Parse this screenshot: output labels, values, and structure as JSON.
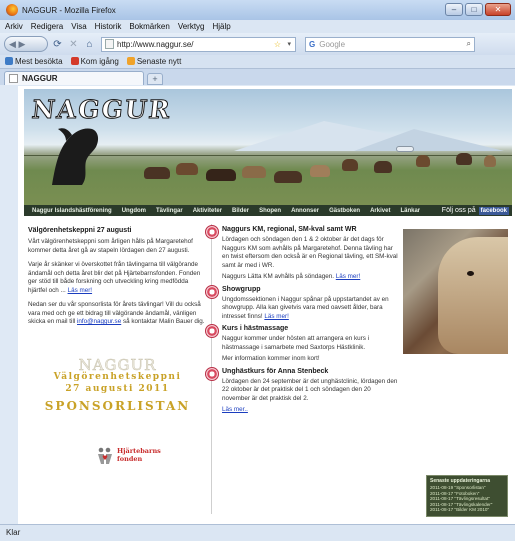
{
  "window": {
    "title": "NAGGUR - Mozilla Firefox"
  },
  "menubar": [
    "Arkiv",
    "Redigera",
    "Visa",
    "Historik",
    "Bokmärken",
    "Verktyg",
    "Hjälp"
  ],
  "navbar": {
    "url": "http://www.naggur.se/",
    "search_placeholder": "Google",
    "search_engine_logo": "G"
  },
  "bookmarks": [
    "Mest besökta",
    "Kom igång",
    "Senaste nytt"
  ],
  "tabs": [
    {
      "label": "NAGGUR"
    }
  ],
  "status": "Klar",
  "page": {
    "logo": "NAGGUR",
    "menu": [
      "Naggur Islandshästförening",
      "Ungdom",
      "Tävlingar",
      "Aktiviteter",
      "Bilder",
      "Shopen",
      "Annonser",
      "Gästboken",
      "Arkivet",
      "Länkar"
    ],
    "follow": {
      "text": "Följ oss på",
      "badge": "facebook"
    },
    "left": {
      "heading": "Välgörenhetskeppni 27 augusti",
      "p1": "Vårt välgörenhetskeppni som årligen hålls på Margaretehof kommer detta året gå av stapeln lördagen den 27 augusti.",
      "p2_text": "Varje år skänker vi överskottet från tävlingarna till välgörande ändamål och detta året blir det på Hjärtebarnsfonden. Fonden ger stöd till både forskning och utveckling kring medfödda hjärtfel och ...",
      "p2_link": "Läs mer!",
      "p3_text": "Nedan ser du vår sponsorlista för årets tävlingar! Vill du också vara med och ge ett bidrag till välgörande ändamål, vänligen skicka en mail till",
      "p3_email": "info@naggur.se",
      "p3_tail": "så kontaktar Malin Bauer dig.",
      "sponsor_logo": "NAGGUR",
      "sponsor_line1": "Välgörenhetskeppni",
      "sponsor_line2": "27 augusti 2011",
      "sponsor_line3": "SPONSORLISTAN",
      "hjarta_1": "Hjärtebarns",
      "hjarta_2": "fonden"
    },
    "news": [
      {
        "title": "Naggurs KM, regional, SM-kval samt WR",
        "p1": "Lördagen och söndagen den 1 & 2 oktober är det dags för Naggurs KM som avhålls på Margaretehof. Denna tävling har en twist eftersom den också är en Regional tävling, ett SM-kval samt är med i WR.",
        "p2_text": "Naggurs Lätta KM avhålls på söndagen.",
        "link": "Läs mer!"
      },
      {
        "title": "Showgrupp",
        "p1_text": "Ungdomssektionen i Naggur spånar på uppstartandet av en showgrupp. Alla kan givetvis vara med oavsett ålder, bara intresset finns!",
        "link": "Läs mer!"
      },
      {
        "title": "Kurs i hästmassage",
        "p1": "Naggur kommer under hösten att arrangera en kurs i hästmassage i samarbete med Saxtorps Hästklinik.",
        "p2": "Mer information kommer inom kort!"
      },
      {
        "title": "Unghästkurs för Anna Stenbeck",
        "p1": "Lördagen den 24 september är det unghästclinic, lördagen den 22 oktober är det praktisk del 1 och söndagen den 20 november är det praktisk del 2.",
        "link": "Läs mer.."
      }
    ],
    "updates": {
      "title": "Senaste uppdateringarna",
      "items": [
        "2011-08-19 \"Sponsorlistan\"",
        "2011-08-17 \"Fotoboken\"",
        "2011-08-17 \"Tävlingsresultat\"",
        "2011-08-17 \"Tävlingskalender\"",
        "2011-08-17 \"Bilder KM 2010\""
      ]
    }
  }
}
